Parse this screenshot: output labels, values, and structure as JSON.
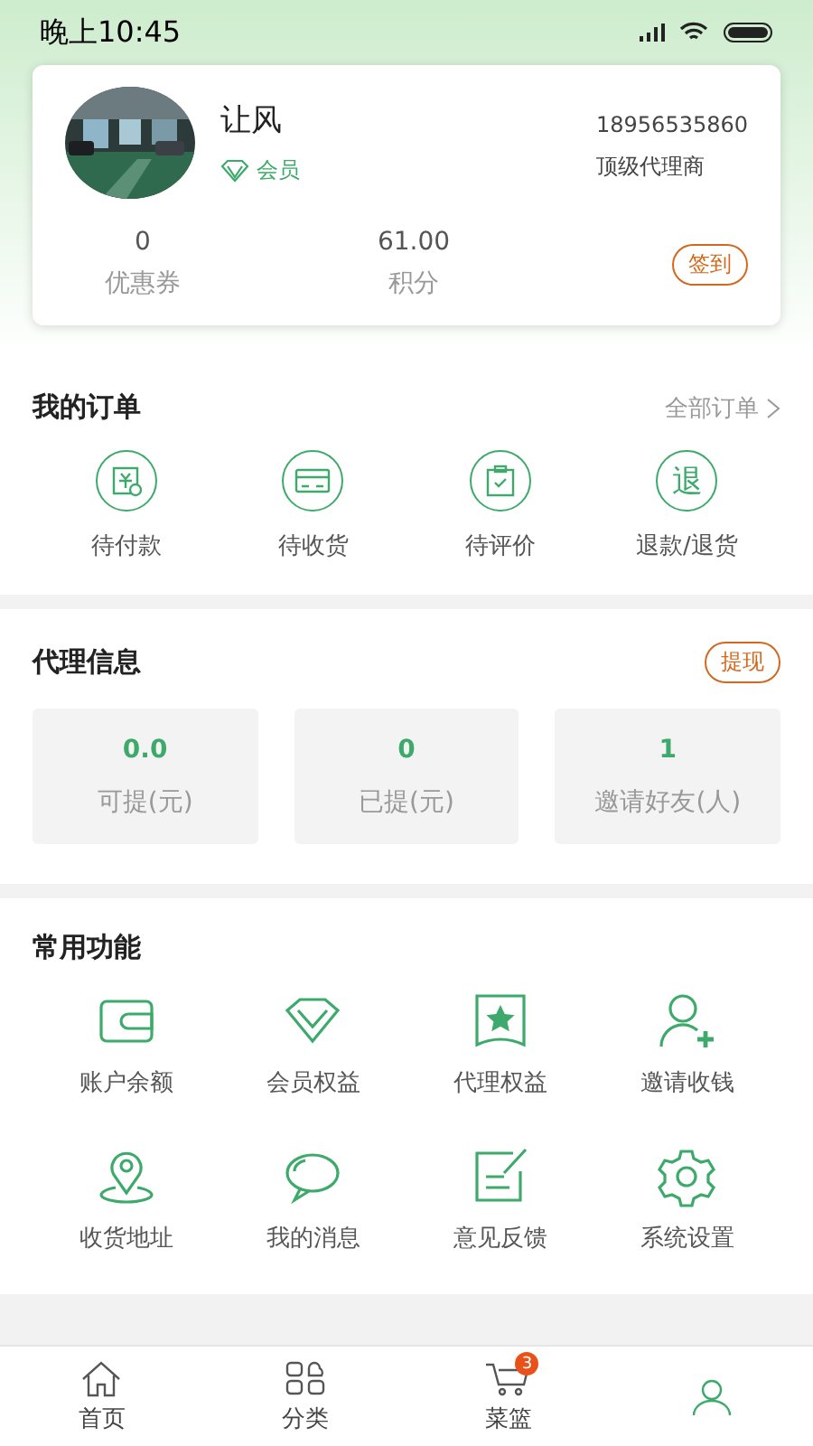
{
  "status_bar": {
    "time": "晚上10:45"
  },
  "profile": {
    "name": "让风",
    "badge": "会员",
    "phone": "18956535860",
    "role": "顶级代理商",
    "stats": [
      {
        "value": "0",
        "label": "优惠券"
      },
      {
        "value": "61.00",
        "label": "积分"
      }
    ],
    "sign_button": "签到"
  },
  "orders": {
    "title": "我的订单",
    "all_link": "全部订单",
    "items": [
      {
        "kind": "pay",
        "label": "待付款"
      },
      {
        "kind": "receive",
        "label": "待收货"
      },
      {
        "kind": "review",
        "label": "待评价"
      },
      {
        "kind": "refund",
        "label": "退款/退货",
        "icon_text": "退"
      }
    ]
  },
  "agent": {
    "title": "代理信息",
    "withdraw_button": "提现",
    "cards": [
      {
        "value": "0.0",
        "label": "可提(元)"
      },
      {
        "value": "0",
        "label": "已提(元)"
      },
      {
        "value": "1",
        "label": "邀请好友(人)"
      }
    ]
  },
  "functions": {
    "title": "常用功能",
    "items": [
      {
        "kind": "wallet",
        "label": "账户余额"
      },
      {
        "kind": "diamond",
        "label": "会员权益"
      },
      {
        "kind": "ribbon",
        "label": "代理权益"
      },
      {
        "kind": "adduser",
        "label": "邀请收钱"
      },
      {
        "kind": "pin",
        "label": "收货地址"
      },
      {
        "kind": "chat",
        "label": "我的消息"
      },
      {
        "kind": "edit",
        "label": "意见反馈"
      },
      {
        "kind": "gear",
        "label": "系统设置"
      }
    ]
  },
  "tab_bar": [
    {
      "kind": "home",
      "label": "首页",
      "selected": false
    },
    {
      "kind": "category",
      "label": "分类",
      "selected": false
    },
    {
      "kind": "cart",
      "label": "菜篮",
      "selected": false,
      "count": "3"
    },
    {
      "kind": "user",
      "selected": true
    }
  ]
}
